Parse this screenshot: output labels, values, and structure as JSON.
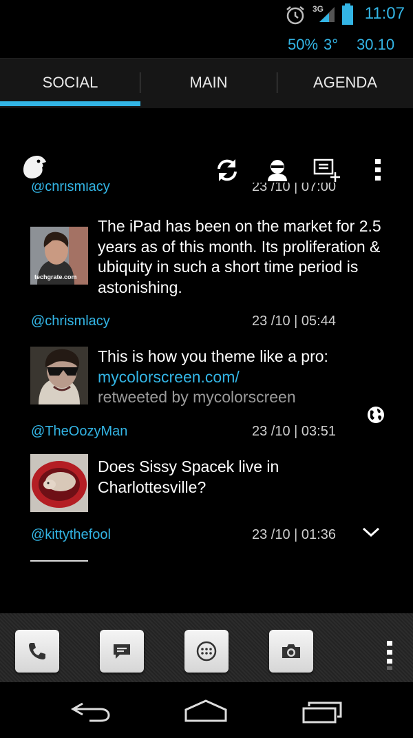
{
  "status": {
    "time": "11:07",
    "signal": "3G",
    "humidity": "50%",
    "temperature": "3°",
    "date": "30.10",
    "icons": [
      "alarm-icon",
      "signal-icon",
      "battery-icon"
    ]
  },
  "tabs": [
    {
      "label": "SOCIAL",
      "selected": true
    },
    {
      "label": "MAIN",
      "selected": false
    },
    {
      "label": "AGENDA",
      "selected": false
    }
  ],
  "widget": {
    "icons": [
      "bird-icon",
      "refresh-icon",
      "profile-icon",
      "compose-icon",
      "overflow-menu-icon"
    ]
  },
  "feed": {
    "partial_handle": "@chrismlacy",
    "partial_stamp": "23 /10 | 07:00",
    "items": [
      {
        "text": "The iPad has been on the market for 2.5 years as of this month. Its proliferation & ubiquity in such a short time period is astonishing.",
        "avatar_caption": "techgrate.com",
        "handle": "@chrismlacy",
        "stamp": "23 /10 | 05:44"
      },
      {
        "text": "This is how you theme like a pro:",
        "link": "mycolorscreen.com/",
        "retweet": "retweeted by mycolorscreen",
        "handle": "@TheOozyMan",
        "stamp": "23 /10 | 03:51"
      },
      {
        "text": "Does Sissy Spacek live in Charlottesville?",
        "handle": "@kittythefool",
        "stamp": "23 /10 | 01:36"
      }
    ],
    "icons": [
      "globe-icon",
      "chevron-down-icon"
    ]
  },
  "dock": {
    "icons": [
      "phone-icon",
      "message-icon",
      "app-drawer-icon",
      "camera-icon",
      "dock-overflow-icon"
    ]
  },
  "nav": {
    "icons": [
      "back-icon",
      "home-icon",
      "recent-apps-icon"
    ]
  },
  "colors": {
    "accent": "#33b5e5",
    "background": "#000000",
    "tab_bar": "#161616"
  }
}
